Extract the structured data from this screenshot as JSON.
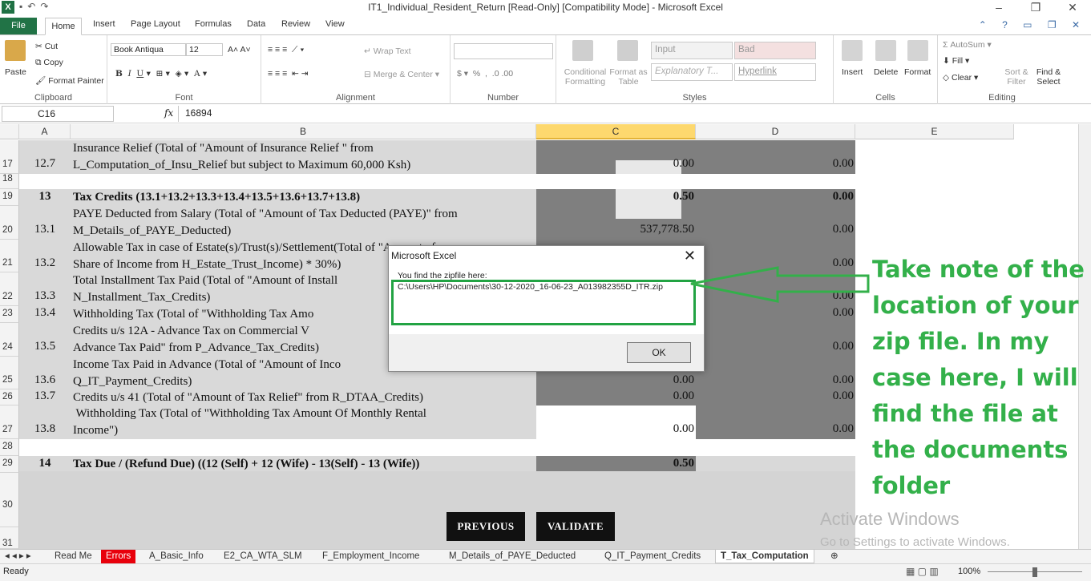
{
  "window": {
    "title": "IT1_Individual_Resident_Return  [Read-Only]  [Compatibility Mode]  -  Microsoft Excel",
    "app_icon": "X",
    "minimize": "–",
    "restore": "❐",
    "close": "✕"
  },
  "ribbon_tabs": [
    "File",
    "Home",
    "Insert",
    "Page Layout",
    "Formulas",
    "Data",
    "Review",
    "View"
  ],
  "ribbon": {
    "clipboard": {
      "paste": "Paste",
      "cut": "Cut",
      "copy": "Copy",
      "format_painter": "Format Painter",
      "label": "Clipboard"
    },
    "font": {
      "name": "Book Antiqua",
      "size": "12",
      "label": "Font"
    },
    "alignment": {
      "wrap": "Wrap Text",
      "merge": "Merge & Center",
      "label": "Alignment"
    },
    "number": {
      "label": "Number"
    },
    "styles": {
      "conditional": "Conditional Formatting",
      "format_table": "Format as Table",
      "input": "Input",
      "bad": "Bad",
      "explanatory": "Explanatory T...",
      "hyperlink": "Hyperlink",
      "label": "Styles"
    },
    "cells": {
      "insert": "Insert",
      "delete": "Delete",
      "format": "Format",
      "label": "Cells"
    },
    "editing": {
      "autosum": "AutoSum",
      "fill": "Fill",
      "clear": "Clear",
      "sort": "Sort & Filter",
      "find": "Find & Select",
      "label": "Editing"
    }
  },
  "formula_bar": {
    "cell_ref": "C16",
    "fx": "fx",
    "value": "16894"
  },
  "columns": [
    "A",
    "B",
    "C",
    "D",
    "E"
  ],
  "rows": [
    {
      "num": "17",
      "a": "12.7",
      "b1": "Insurance Relief (Total of \"Amount of Insurance Relief \" from",
      "b2": "L_Computation_of_Insu_Relief but subject to Maximum 60,000 Ksh)",
      "c": "0.00",
      "d": "0.00"
    },
    {
      "num": "18"
    },
    {
      "num": "19",
      "a": "13",
      "b1": "Tax Credits (13.1+13.2+13.3+13.4+13.5+13.6+13.7+13.8)",
      "c": "0.50",
      "d": "0.00"
    },
    {
      "num": "20",
      "a": "13.1",
      "b1": "PAYE Deducted from Salary (Total of \"Amount of Tax Deducted (PAYE)\" from",
      "b2": "M_Details_of_PAYE_Deducted)",
      "c": "537,778.50",
      "d": "0.00"
    },
    {
      "num": "21",
      "a": "13.2",
      "b1": "Allowable Tax in case of Estate(s)/Trust(s)/Settlement(Total of \"Amount of",
      "b2": "Share of Income from H_Estate_Trust_Income) * 30%)",
      "c": "",
      "d": "0.00"
    },
    {
      "num": "22",
      "a": "13.3",
      "b1": "Total Installment Tax Paid (Total of \"Amount of Install",
      "b2": "N_Installment_Tax_Credits)",
      "c": "",
      "d": "0.00"
    },
    {
      "num": "23",
      "a": "13.4",
      "b1": "Withholding Tax (Total of \"Withholding Tax Amo",
      "c": "",
      "d": "0.00"
    },
    {
      "num": "24",
      "a": "13.5",
      "b1": "Credits u/s 12A - Advance Tax on Commercial V",
      "b2": "Advance Tax Paid\" from P_Advance_Tax_Credits)",
      "c": "",
      "d": "0.00"
    },
    {
      "num": "25",
      "a": "13.6",
      "b1": "Income Tax Paid in Advance (Total of \"Amount of Inco",
      "b2": "Q_IT_Payment_Credits)",
      "c": "0.00",
      "d": "0.00"
    },
    {
      "num": "26",
      "a": "13.7",
      "b1": "Credits u/s 41 (Total of \"Amount of Tax Relief\" from R_DTAA_Credits)",
      "c": "0.00",
      "d": "0.00"
    },
    {
      "num": "27",
      "a": "13.8",
      "b1": " Withholding Tax (Total of \"Withholding Tax Amount Of Monthly Rental",
      "b2": "Income\")",
      "c": "0.00",
      "d": "0.00"
    },
    {
      "num": "28"
    },
    {
      "num": "29",
      "a": "14",
      "b1": "Tax Due / (Refund Due) ((12 (Self) + 12 (Wife) - 13(Self) - 13 (Wife))",
      "c": "0.50"
    },
    {
      "num": "30"
    },
    {
      "num": "31"
    }
  ],
  "buttons": {
    "previous": "PREVIOUS",
    "validate": "VALIDATE"
  },
  "dialog": {
    "title": "Microsoft Excel",
    "line1": "You find the zipfile here:",
    "line2": "C:\\Users\\HP\\Documents\\30-12-2020_16-06-23_A013982355D_ITR.zip",
    "ok": "OK"
  },
  "annotation": "Take note of the location of your zip file. In my case here, I will find the file at the documents folder",
  "annotation_color": "#33b04a",
  "watermark": {
    "line1": "Activate Windows",
    "line2": "Go to Settings to activate Windows."
  },
  "sheet_tabs": [
    "Read Me",
    "Errors",
    "A_Basic_Info",
    "E2_CA_WTA_SLM",
    "F_Employment_Income",
    "M_Details_of_PAYE_Deducted",
    "Q_IT_Payment_Credits",
    "T_Tax_Computation"
  ],
  "status": {
    "ready": "Ready",
    "zoom": "100%"
  }
}
